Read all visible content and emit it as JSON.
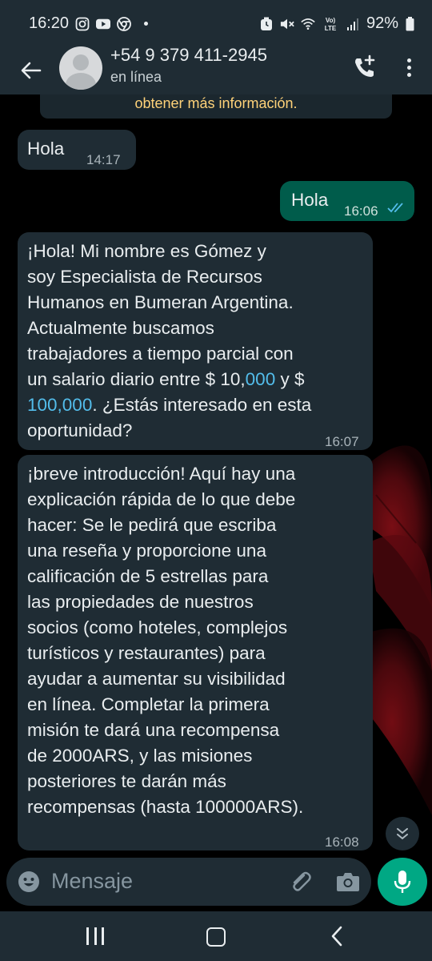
{
  "status_bar": {
    "time": "16:20",
    "battery": "92%",
    "notification_icons": [
      "instagram-icon",
      "youtube-icon",
      "chrome-icon"
    ],
    "system_icons": [
      "alarm-icon",
      "mute-icon",
      "wifi-icon",
      "volte-icon",
      "signal-icon",
      "battery-icon"
    ]
  },
  "header": {
    "contact_name": "+54 9 379 411-2945",
    "contact_status": "en línea",
    "actions": [
      "add-call-icon",
      "more-options-icon"
    ]
  },
  "chat": {
    "notice_text": "obtener más información.",
    "messages": [
      {
        "direction": "in",
        "text": "Hola",
        "time": "14:17"
      },
      {
        "direction": "out",
        "text": "Hola",
        "time": "16:06",
        "status": "read"
      },
      {
        "direction": "in",
        "text_before_1": "¡Hola! Mi nombre es Gómez y",
        "line_2": "soy Especialista de Recursos",
        "line_3": "Humanos en Bumeran Argentina.",
        "line_4": "Actualmente buscamos",
        "line_5": "trabajadores a tiempo parcial con",
        "line_6_prefix": "un salario diario entre $ 10,",
        "line_6_link": "000",
        "line_6_suffix": " y $",
        "line_7_link": "100,000",
        "line_7_suffix": ". ¿Estás interesado en esta",
        "line_8": "oportunidad?",
        "time": "16:07"
      },
      {
        "direction": "in",
        "lines": [
          "¡breve introducción! Aquí hay una",
          "explicación rápida de lo que debe",
          "hacer: Se le pedirá que escriba",
          "una reseña y proporcione una",
          "calificación de 5 estrellas para",
          "las propiedades de nuestros",
          "socios (como hoteles, complejos",
          "turísticos y restaurantes) para",
          "ayudar a aumentar su visibilidad",
          "en línea. Completar la primera",
          "misión te dará una recompensa",
          "de 2000ARS, y las misiones",
          "posteriores te darán más",
          "recompensas (hasta 100000ARS)."
        ],
        "time": "16:08"
      }
    ]
  },
  "composer": {
    "placeholder": "Mensaje"
  },
  "colors": {
    "bar_bg": "#1f2c34",
    "incoming_bubble": "#1f2c34",
    "outgoing_bubble": "#005c4b",
    "accent": "#00a884",
    "link": "#53bdeb",
    "notice": "#ffd279"
  }
}
